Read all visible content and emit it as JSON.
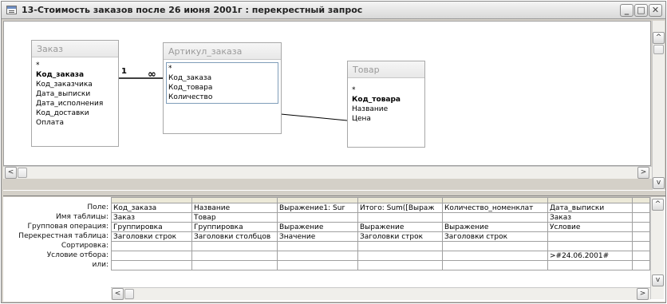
{
  "window": {
    "title": "13-Стоимость заказов после 26 июня 2001г : перекрестный запрос",
    "buttons": {
      "minimize": "_",
      "maximize": "□",
      "close": "✕"
    }
  },
  "diagram": {
    "tables": [
      {
        "name": "Заказ",
        "fields": [
          "*",
          "Код_заказа",
          "Код_заказчика",
          "Дата_выписки",
          "Дата_исполнения",
          "Код_доставки",
          "Оплата"
        ],
        "key_field": "Код_заказа"
      },
      {
        "name": "Артикул_заказа",
        "fields": [
          "*",
          "Код_заказа",
          "Код_товара",
          "Количество"
        ],
        "key_field": ""
      },
      {
        "name": "Товар",
        "fields": [
          "*",
          "Код_товара",
          "Название",
          "Цена"
        ],
        "key_field": "Код_товара"
      }
    ],
    "relation": {
      "one_label": "1",
      "many_label": "∞"
    }
  },
  "scrollbar": {
    "up": "^",
    "down": "v",
    "left": "<",
    "right": ">"
  },
  "grid": {
    "row_labels": [
      "Поле:",
      "Имя таблицы:",
      "Групповая операция:",
      "Перекрестная таблица:",
      "Сортировка:",
      "Условие отбора:",
      "или:"
    ],
    "columns": [
      {
        "field": "Код_заказа",
        "table": "Заказ",
        "group": "Группировка",
        "crosstab": "Заголовки строк",
        "sort": "",
        "criteria": "",
        "or": ""
      },
      {
        "field": "Название",
        "table": "Товар",
        "group": "Группировка",
        "crosstab": "Заголовки столбцов",
        "sort": "",
        "criteria": "",
        "or": ""
      },
      {
        "field": "Выражение1: Sur",
        "table": "",
        "group": "Выражение",
        "crosstab": "Значение",
        "sort": "",
        "criteria": "",
        "or": ""
      },
      {
        "field": "Итого: Sum([Выраж",
        "table": "",
        "group": "Выражение",
        "crosstab": "Заголовки строк",
        "sort": "",
        "criteria": "",
        "or": ""
      },
      {
        "field": "Количество_номенклат",
        "table": "",
        "group": "Выражение",
        "crosstab": "Заголовки строк",
        "sort": "",
        "criteria": "",
        "or": ""
      },
      {
        "field": "Дата_выписки",
        "table": "Заказ",
        "group": "Условие",
        "crosstab": "",
        "sort": "",
        "criteria": ">#24.06.2001#",
        "or": ""
      },
      {
        "field": "",
        "table": "",
        "group": "",
        "crosstab": "",
        "sort": "",
        "criteria": "",
        "or": ""
      }
    ]
  }
}
